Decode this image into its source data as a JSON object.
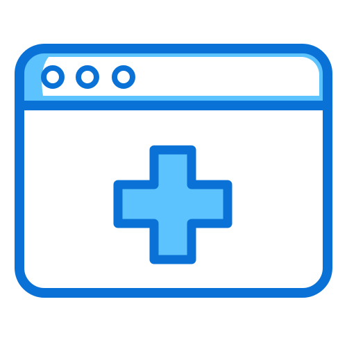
{
  "icon": {
    "name": "medical-browser-window-icon",
    "parts": {
      "window": "browser-window-icon",
      "dots": [
        "window-dot-icon",
        "window-dot-icon",
        "window-dot-icon"
      ],
      "cross": "medical-cross-icon"
    }
  },
  "colors": {
    "outline": "#0a72d6",
    "fill_light": "#5cc3ff",
    "background": "#ffffff"
  }
}
